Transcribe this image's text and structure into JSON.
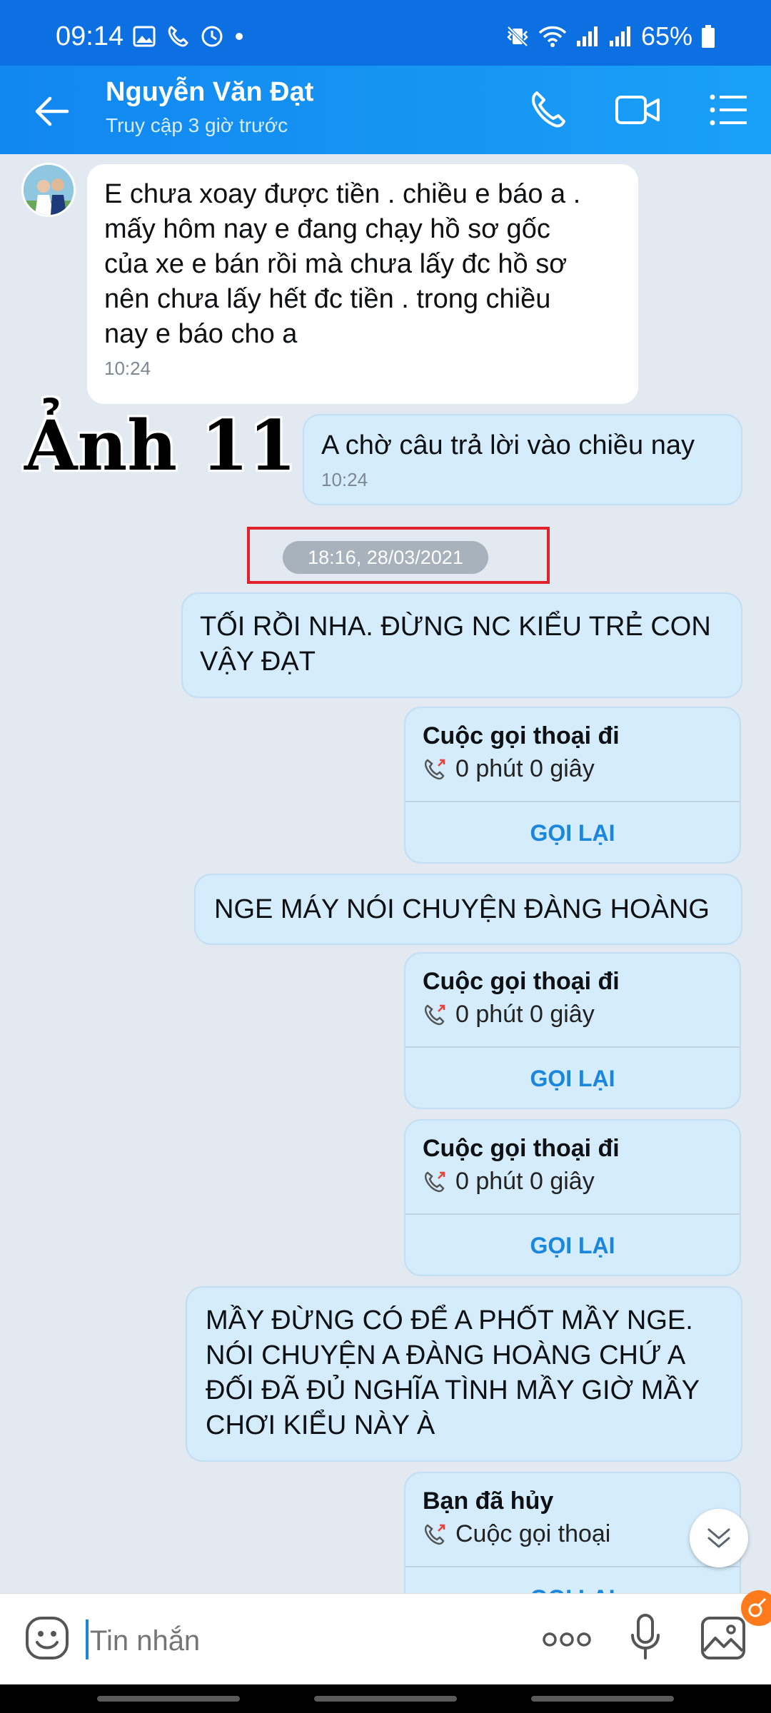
{
  "status_bar": {
    "time": "09:14",
    "battery": "65%"
  },
  "header": {
    "contact_name": "Nguyễn Văn Đạt",
    "last_seen": "Truy cập 3 giờ trước"
  },
  "watermark": "Ảnh 11",
  "messages": {
    "m1_text": "E chưa xoay được tiền . chiều e báo a .\nmấy hôm nay e đang chạy hồ sơ gốc\ncủa xe e bán rồi mà chưa lấy đc hồ sơ\nnên chưa lấy hết đc tiền . trong chiều\nnay e báo cho a",
    "m1_time": "10:24",
    "m2_text": "A chờ câu trả lời vào chiều nay",
    "m2_time": "10:24",
    "date_separator": "18:16, 28/03/2021",
    "m3_text": "TỐI RỒI NHA. ĐỪNG NC KIỂU TRẺ CON\nVẬY ĐẠT",
    "m4_text": "NGE MÁY NÓI CHUYỆN ĐÀNG HOÀNG",
    "m5_text": "MẦY ĐỪNG CÓ ĐỂ A PHỐT MẦY NGE.\nNÓI CHUYỆN A ĐÀNG HOÀNG CHỨ A\nĐỐI ĐÃ ĐỦ NGHĨA TÌNH MẦY GIỜ MẦY\nCHƠI KIỂU NÀY À"
  },
  "calls": [
    {
      "title": "Cuộc gọi thoại đi",
      "detail": "0 phút 0 giây",
      "action": "GỌI LẠI"
    },
    {
      "title": "Cuộc gọi thoại đi",
      "detail": "0 phút 0 giây",
      "action": "GỌI LẠI"
    },
    {
      "title": "Cuộc gọi thoại đi",
      "detail": "0 phút 0 giây",
      "action": "GỌI LẠI"
    },
    {
      "title": "Bạn đã hủy",
      "detail": "Cuộc gọi thoại",
      "action": "GỌI LẠI"
    }
  ],
  "composer": {
    "placeholder": "Tin nhắn"
  },
  "colors": {
    "header": "#1187f0",
    "outgoing_bubble": "#d4ecfb",
    "accent": "#1a86de",
    "highlight_box": "#e0222b"
  },
  "icons": [
    "back-arrow-icon",
    "phone-icon",
    "video-call-icon",
    "menu-icon",
    "outgoing-call-icon",
    "chevron-down-icon",
    "emoji-icon",
    "more-icon",
    "microphone-icon",
    "image-icon"
  ]
}
